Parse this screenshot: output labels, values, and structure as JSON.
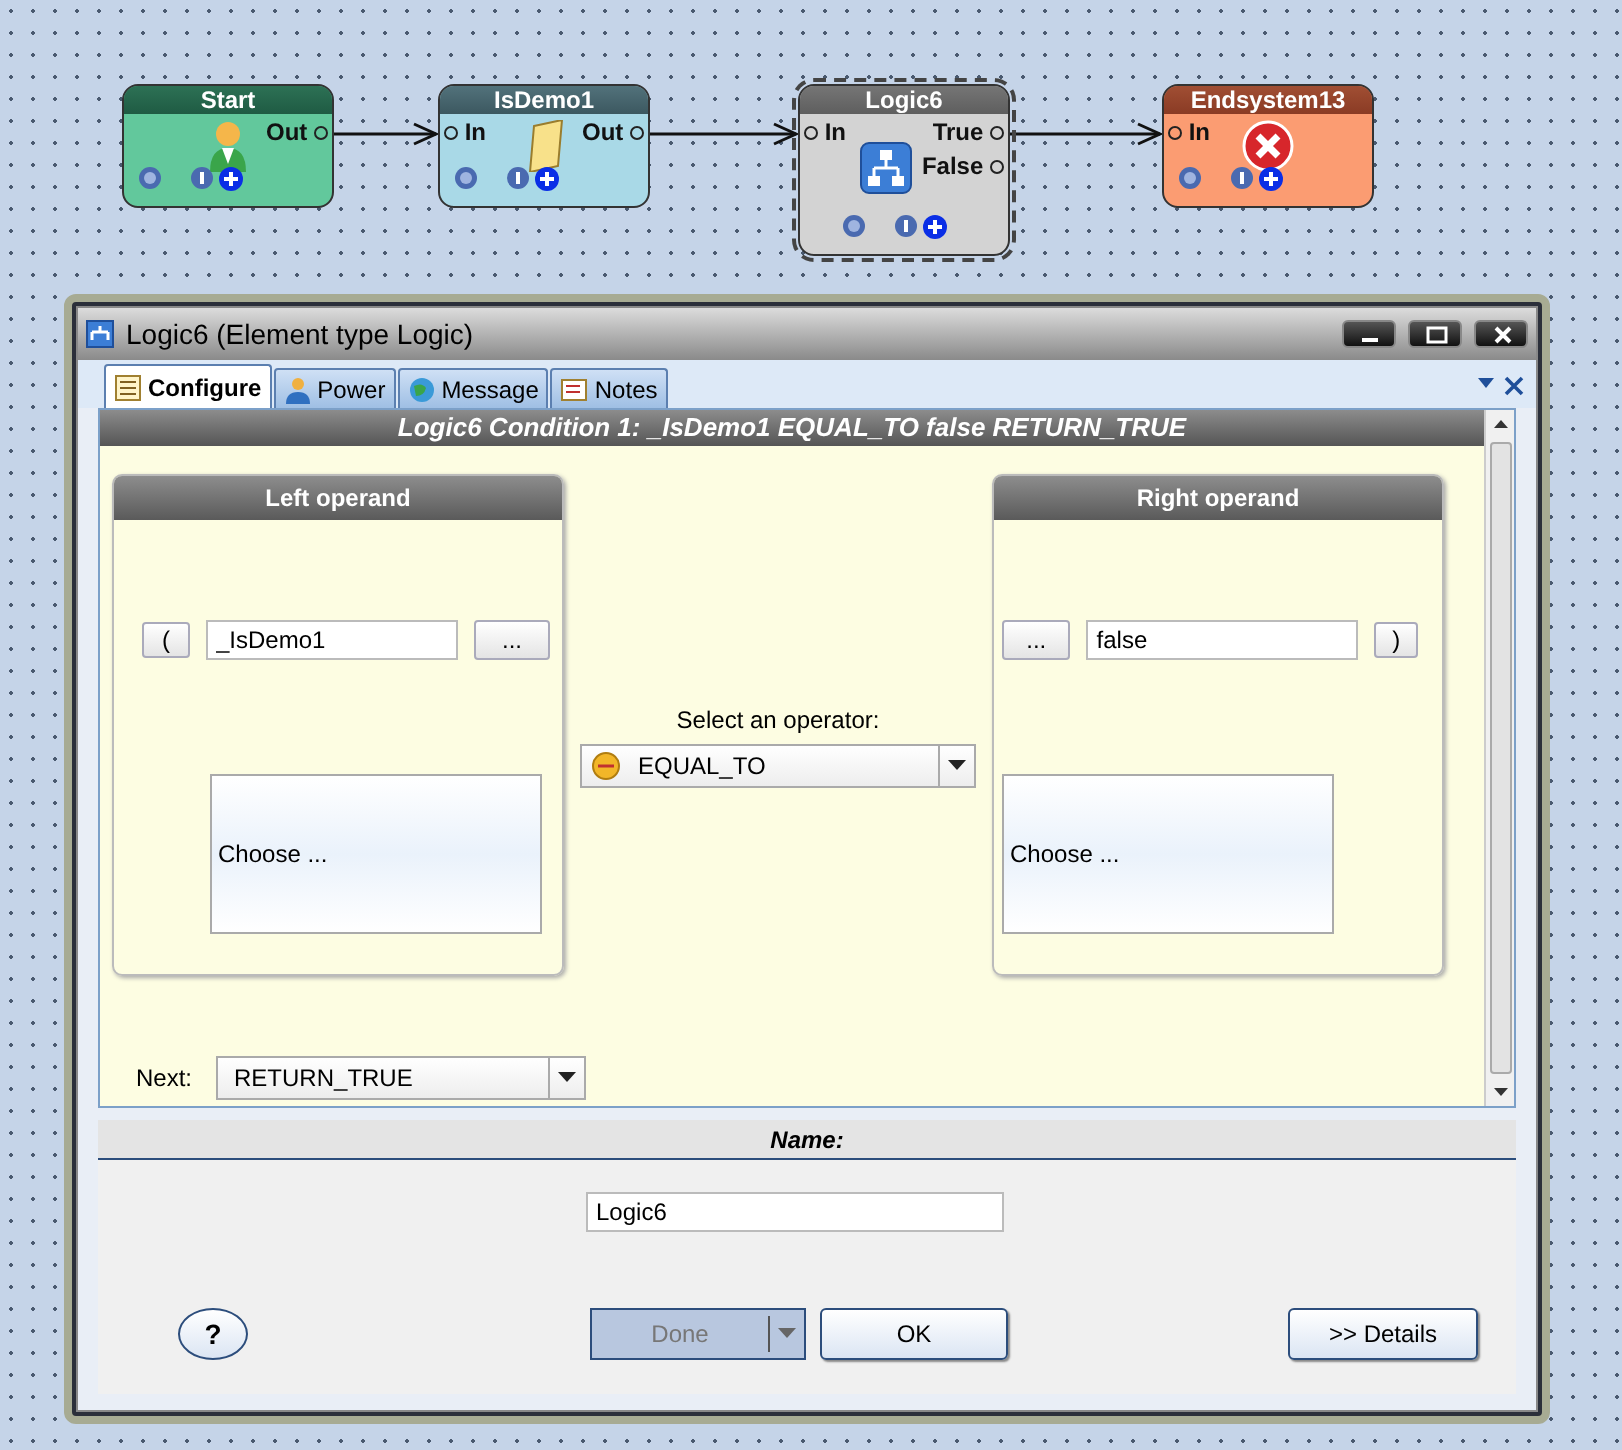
{
  "nodes": [
    {
      "kind": "start",
      "title": "Start",
      "color": "#62c89c",
      "selected": false,
      "outputs": [
        "Out"
      ]
    },
    {
      "kind": "function",
      "title": "IsDemo1",
      "color": "#a9d9e7",
      "selected": false,
      "inputs": [
        "In"
      ],
      "outputs": [
        "Out"
      ]
    },
    {
      "kind": "logic",
      "title": "Logic6",
      "color": "#d3d3d3",
      "selected": true,
      "inputs": [
        "In"
      ],
      "outputs": [
        "True",
        "False"
      ]
    },
    {
      "kind": "end",
      "title": "Endsystem13",
      "color": "#fb9c72",
      "selected": false,
      "inputs": [
        "In"
      ]
    }
  ],
  "dialog": {
    "title": "Logic6 (Element type Logic)",
    "tabs": [
      {
        "label": "Configure",
        "selected": true
      },
      {
        "label": "Power",
        "selected": false
      },
      {
        "label": "Message",
        "selected": false
      },
      {
        "label": "Notes",
        "selected": false
      }
    ],
    "condition": "Logic6  Condition 1:  _IsDemo1 EQUAL_TO false  RETURN_TRUE",
    "left": {
      "header": "Left operand",
      "paren": "(",
      "value": "_IsDemo1",
      "browse": "...",
      "choose": "Choose ..."
    },
    "operator": {
      "label": "Select an operator:",
      "value": "EQUAL_TO"
    },
    "right": {
      "header": "Right operand",
      "paren": ")",
      "value": "false",
      "browse": "...",
      "choose": "Choose ..."
    },
    "next": {
      "label": "Next:",
      "value": "RETURN_TRUE"
    },
    "name": {
      "label": "Name:",
      "value": "Logic6"
    },
    "help": "?",
    "buttons": [
      {
        "kind": "split",
        "label": "Done",
        "disabled": true
      },
      {
        "kind": "plain",
        "label": "OK",
        "disabled": false
      },
      {
        "kind": "details",
        "label": ">> Details",
        "disabled": false
      }
    ]
  }
}
